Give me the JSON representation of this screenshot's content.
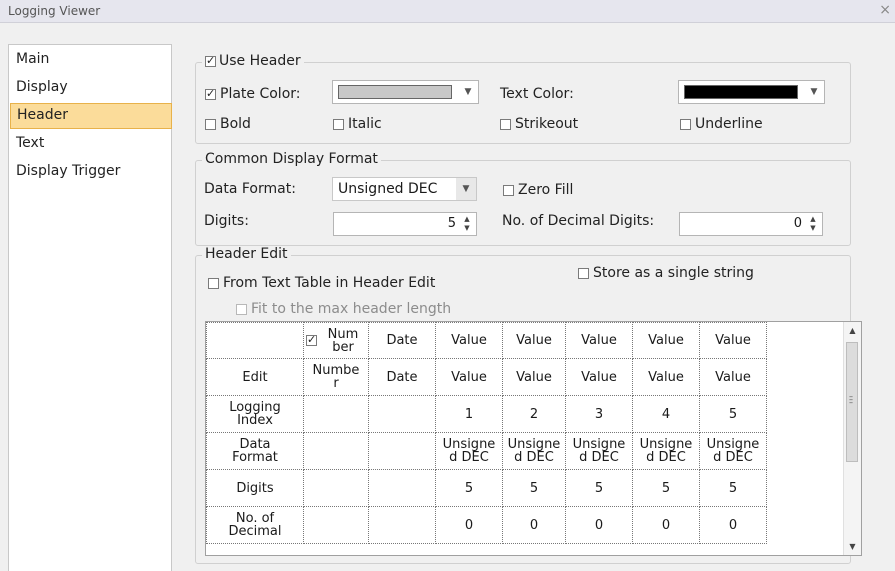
{
  "window": {
    "title": "Logging Viewer",
    "close_glyph": "×"
  },
  "nav": {
    "items": [
      "Main",
      "Display",
      "Header",
      "Text",
      "Display Trigger"
    ],
    "selected": "Header"
  },
  "header": {
    "use_header": {
      "label": "Use Header",
      "checked": true
    },
    "plate_color": {
      "label": "Plate Color:",
      "checked": true,
      "color": "#c8c8c8"
    },
    "text_color": {
      "label": "Text Color:",
      "color": "#000000"
    },
    "bold": {
      "label": "Bold",
      "checked": false
    },
    "italic": {
      "label": "Italic",
      "checked": false
    },
    "strikeout": {
      "label": "Strikeout",
      "checked": false
    },
    "underline": {
      "label": "Underline",
      "checked": false
    }
  },
  "common": {
    "legend": "Common Display Format",
    "data_format_label": "Data Format:",
    "data_format_value": "Unsigned DEC",
    "zero_fill_label": "Zero Fill",
    "digits_label": "Digits:",
    "digits_value": "5",
    "decimal_label": "No. of Decimal Digits:",
    "decimal_value": "0"
  },
  "edit": {
    "legend": "Header Edit",
    "from_text_table": "From Text Table in Header Edit",
    "store_single": "Store as a single string",
    "fit_max": "Fit to the max header length"
  },
  "grid": {
    "header_row": [
      "",
      "Num\nber",
      "Date",
      "Value",
      "Value",
      "Value",
      "Value",
      "Value"
    ],
    "rows": [
      {
        "label": "Edit",
        "cells": [
          "Numbe\nr",
          "Date",
          "Value",
          "Value",
          "Value",
          "Value",
          "Value"
        ]
      },
      {
        "label": "Logging\nIndex",
        "cells": [
          "",
          "",
          "1",
          "2",
          "3",
          "4",
          "5"
        ]
      },
      {
        "label": "Data\nFormat",
        "cells": [
          "",
          "",
          "Unsigne\nd DEC",
          "Unsigne\nd DEC",
          "Unsigne\nd DEC",
          "Unsigne\nd DEC",
          "Unsigne\nd DEC"
        ]
      },
      {
        "label": "Digits",
        "cells": [
          "",
          "",
          "5",
          "5",
          "5",
          "5",
          "5"
        ]
      },
      {
        "label": "No. of\nDecimal",
        "cells": [
          "",
          "",
          "0",
          "0",
          "0",
          "0",
          "0"
        ]
      }
    ]
  }
}
